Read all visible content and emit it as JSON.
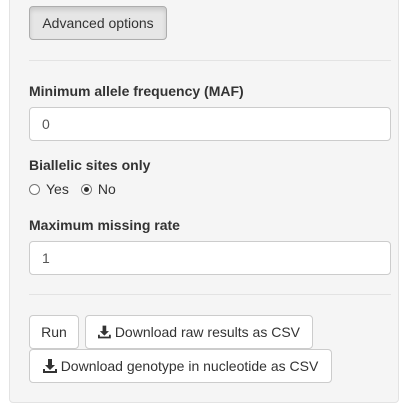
{
  "advanced_button": {
    "label": "Advanced options"
  },
  "maf": {
    "label": "Minimum allele frequency (MAF)",
    "value": "0"
  },
  "biallelic": {
    "label": "Biallelic sites only",
    "options": [
      {
        "label": "Yes",
        "checked": false
      },
      {
        "label": "No",
        "checked": true
      }
    ]
  },
  "missing": {
    "label": "Maximum missing rate",
    "value": "1"
  },
  "actions": {
    "run_label": "Run",
    "download_raw_label": "Download raw results as CSV",
    "download_genotype_label": "Download genotype in nucleotide as CSV"
  },
  "icons": {
    "download": "download-icon"
  }
}
